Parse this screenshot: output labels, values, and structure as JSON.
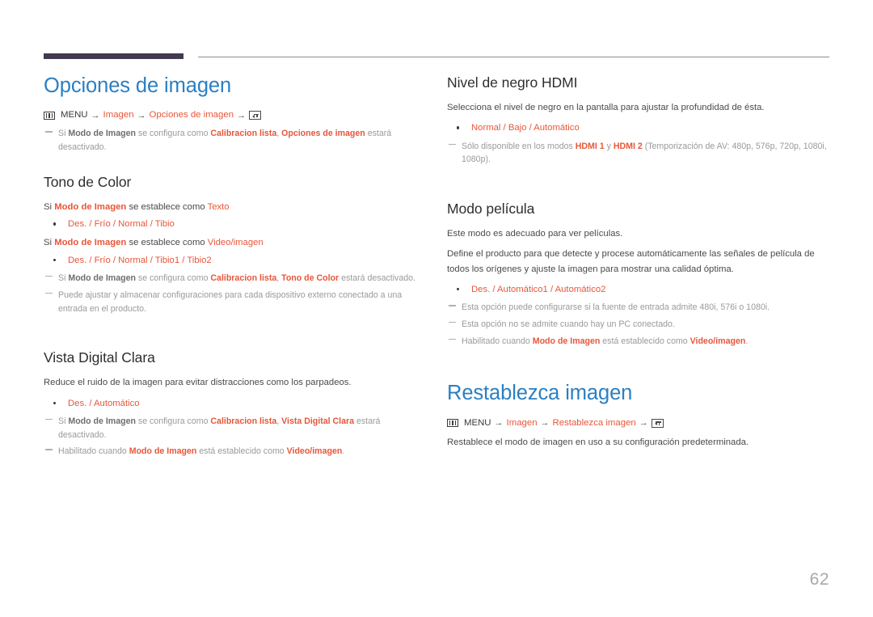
{
  "document": {
    "page_number": "62",
    "accent_blue": "#2a7fc3",
    "accent_orange": "#e8563a",
    "rule_dark": "#433a50",
    "note_gray": "#9a9a9a"
  },
  "icons": {
    "menu": "menu-icon",
    "enter": "enter-key-icon",
    "arrow": "→"
  },
  "left_column": {
    "title": "Opciones de imagen",
    "menu_path": {
      "menu_label": "MENU",
      "step1": "Imagen",
      "step2": "Opciones de imagen"
    },
    "title_note": {
      "pre": "Si ",
      "term1": "Modo de Imagen",
      "mid1": " se configura como ",
      "term2": "Calibracion lista",
      "mid2": ", ",
      "term3": "Opciones de imagen",
      "post": " estará desactivado."
    },
    "sections": [
      {
        "heading": "Tono de Color",
        "line1_pre": "Si ",
        "line1_term": "Modo de Imagen",
        "line1_mid": " se establece como ",
        "line1_value": "Texto",
        "options1": "Des. / Frío / Normal / Tibio",
        "line2_pre": "Si ",
        "line2_term": "Modo de Imagen",
        "line2_mid": " se establece como ",
        "line2_value": "Video/imagen",
        "options2": "Des. / Frío / Normal / Tibio1 / Tibio2",
        "note1": {
          "pre": "Si ",
          "term1": "Modo de Imagen",
          "mid1": " se configura como ",
          "term2": "Calibracion lista",
          "mid2": ", ",
          "term3": "Tono de Color",
          "post": " estará desactivado."
        },
        "note2": "Puede ajustar y almacenar configuraciones para cada dispositivo externo conectado a una entrada en el producto."
      },
      {
        "heading": "Vista Digital Clara",
        "description": "Reduce el ruido de la imagen para evitar distracciones como los parpadeos.",
        "options": "Des. / Automático",
        "note1": {
          "pre": "Si ",
          "term1": "Modo de Imagen",
          "mid1": " se configura como ",
          "term2": "Calibracion lista",
          "mid2": ", ",
          "term3": "Vista Digital Clara",
          "post": " estará desactivado."
        },
        "note2": {
          "pre": "Habilitado cuando ",
          "term1": "Modo de Imagen",
          "mid1": " está establecido como ",
          "term2": "Video/imagen",
          "post": "."
        }
      }
    ]
  },
  "right_column": {
    "sections": [
      {
        "heading": "Nivel de negro HDMI",
        "description": "Selecciona el nivel de negro en la pantalla para ajustar la profundidad de ésta.",
        "options": "Normal / Bajo / Automático",
        "note": {
          "pre": "Sólo disponible en los modos ",
          "term1": "HDMI 1",
          "mid1": " y ",
          "term2": "HDMI 2",
          "post": " (Temporización de AV: 480p, 576p, 720p, 1080i, 1080p)."
        }
      },
      {
        "heading": "Modo película",
        "description1": "Este modo es adecuado para ver películas.",
        "description2": "Define el producto para que detecte y procese automáticamente las señales de película de todos los orígenes y ajuste la imagen para mostrar una calidad óptima.",
        "options": "Des. / Automático1 / Automático2",
        "note1": "Esta opción puede configurarse si la fuente de entrada admite 480i, 576i o 1080i.",
        "note2": "Esta opción no se admite cuando hay un PC conectado.",
        "note3": {
          "pre": "Habilitado cuando ",
          "term1": "Modo de Imagen",
          "mid1": " está establecido como ",
          "term2": "Video/imagen",
          "post": "."
        }
      }
    ],
    "reset_title": "Restablezca imagen",
    "reset_menu_path": {
      "menu_label": "MENU",
      "step1": "Imagen",
      "step2": "Restablezca imagen"
    },
    "reset_description": "Restablece el modo de imagen en uso a su configuración predeterminada."
  }
}
